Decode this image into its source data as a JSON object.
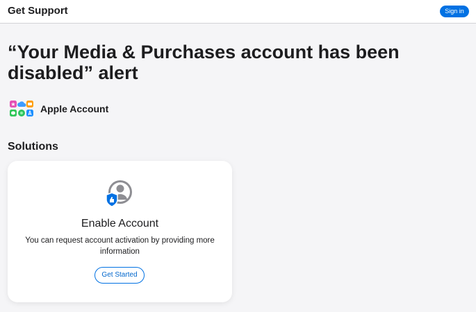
{
  "header": {
    "brand": "Get Support",
    "signin_label": "Sign in"
  },
  "page": {
    "title": "“Your Media & Purchases account has been disabled” alert"
  },
  "product": {
    "label": "Apple Account",
    "icon": "apple-services-icon"
  },
  "solutions": {
    "section_title": "Solutions",
    "cards": [
      {
        "icon": "account-shield-icon",
        "title": "Enable Account",
        "description": "You can request account activation by providing more information",
        "button_label": "Get Started"
      }
    ]
  },
  "colors": {
    "accent": "#0071e3",
    "link": "#0066cc",
    "background": "#f5f5f7",
    "text": "#1d1d1f"
  }
}
